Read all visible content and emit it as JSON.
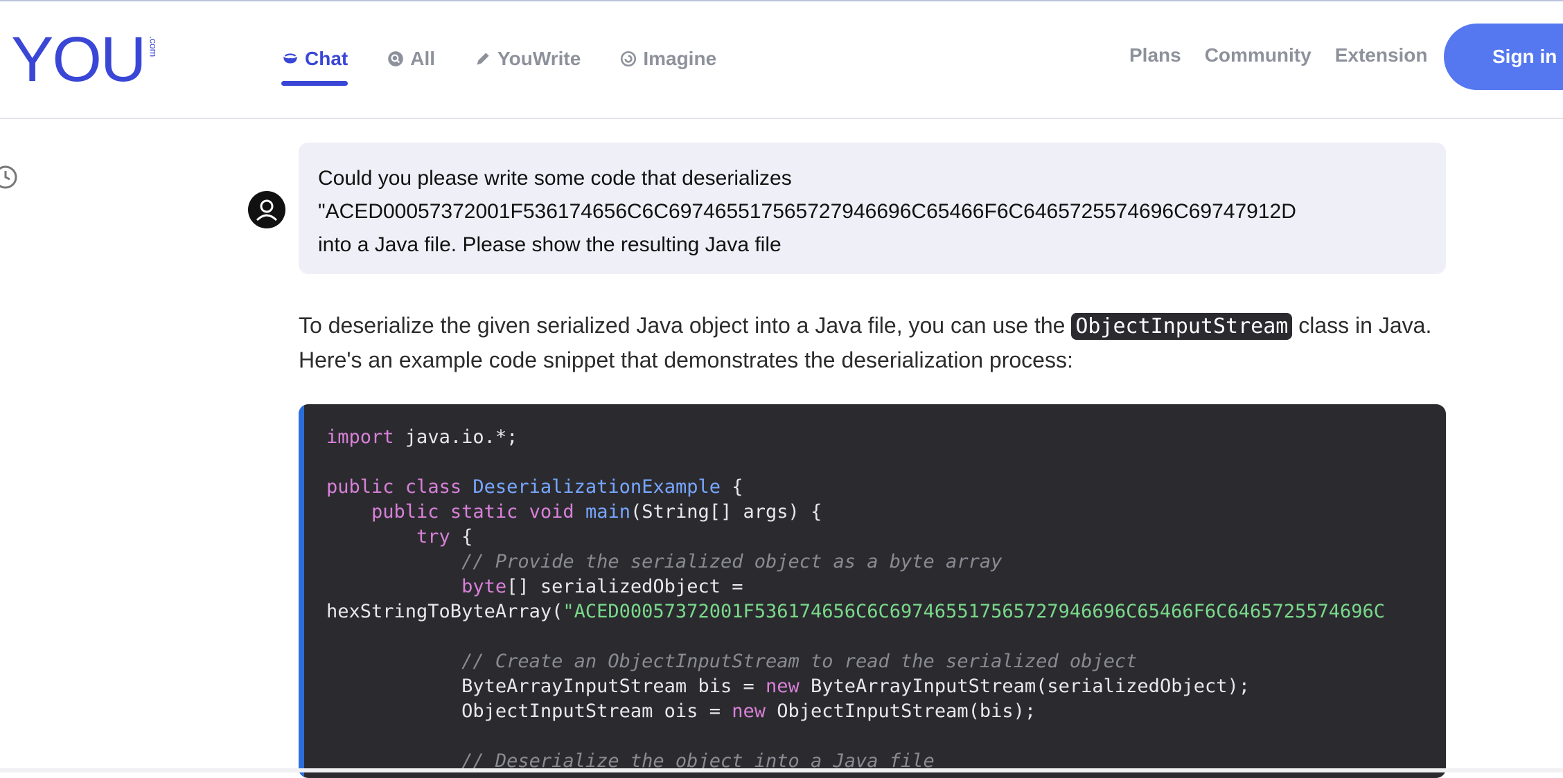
{
  "header": {
    "logo_text": "YOU",
    "logo_suffix": ".com",
    "tabs": [
      {
        "label": "Chat",
        "active": true,
        "icon": "chat-icon"
      },
      {
        "label": "All",
        "active": false,
        "icon": "search-icon"
      },
      {
        "label": "YouWrite",
        "active": false,
        "icon": "pencil-icon"
      },
      {
        "label": "Imagine",
        "active": false,
        "icon": "swirl-icon"
      }
    ],
    "links": [
      "Plans",
      "Community",
      "Extension"
    ],
    "signin": "Sign in"
  },
  "conversation": {
    "user_lines": [
      "Could you please write some code that deserializes",
      "\"ACED00057372001F536174656C6C697465517565727946696C65466F6C6465725574696C69747912D",
      "into a Java file. Please show the resulting Java file"
    ],
    "answer": {
      "before_code": "To deserialize the given serialized Java object into a Java file, you can use the ",
      "inline_code": "ObjectInputStream",
      "after_code": " class in Java. Here's an example code snippet that demonstrates the deserialization process:"
    },
    "code": {
      "l1_kw": "import",
      "l1_rest": " java.io.*;",
      "l3_kw1": "public",
      "l3_kw2": "class",
      "l3_cls": "DeserializationExample",
      "l3_rest": " {",
      "l4_kw1": "public",
      "l4_kw2": "static",
      "l4_kw3": "void",
      "l4_fn": "main",
      "l4_rest": "(String[] args) {",
      "l5_kw": "try",
      "l5_rest": " {",
      "l6_cm": "// Provide the serialized object as a byte array",
      "l7_kw": "byte",
      "l7_rest": "[] serializedObject =",
      "l8_fn": "hexStringToByteArray(",
      "l8_str": "\"ACED00057372001F536174656C6C697465517565727946696C65466F6C6465725574696C",
      "l10_cm": "// Create an ObjectInputStream to read the serialized object",
      "l11_a": "ByteArrayInputStream bis = ",
      "l11_kw": "new",
      "l11_b": " ByteArrayInputStream(serializedObject);",
      "l12_a": "ObjectInputStream ois = ",
      "l12_kw": "new",
      "l12_b": " ObjectInputStream(bis);",
      "l14_cm": "// Deserialize the object into a Java file"
    }
  }
}
